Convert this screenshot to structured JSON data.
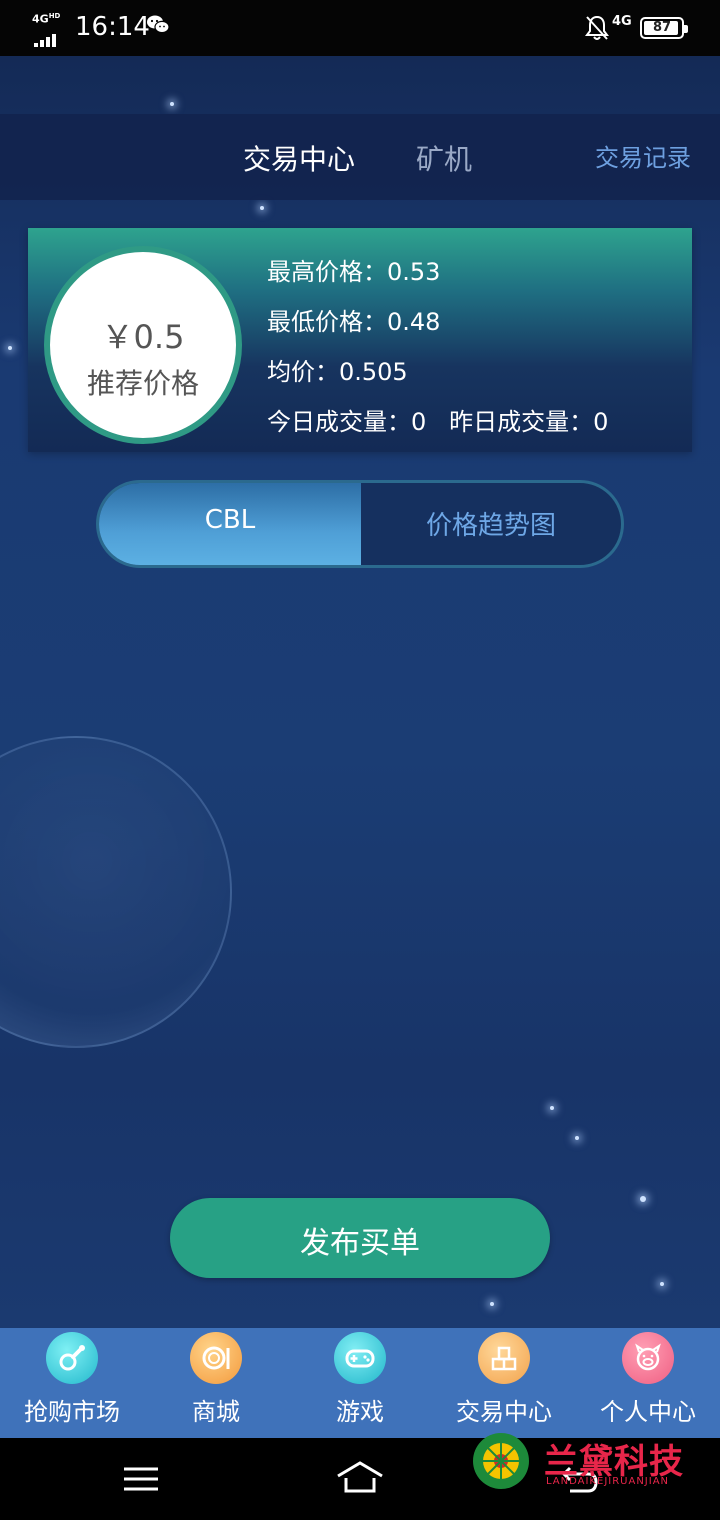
{
  "status_bar": {
    "network_tag": "4G",
    "network_tag_sup": "HD",
    "time": "16:14",
    "network_type": "4G",
    "battery": "87"
  },
  "header": {
    "tab_trade": "交易中心",
    "tab_miner": "矿机",
    "records_link": "交易记录"
  },
  "price_card": {
    "recommended_price": "￥0.5",
    "recommended_label": "推荐价格",
    "stats": {
      "high": "最高价格：0.53",
      "low": "最低价格：0.48",
      "avg": "均价：0.505",
      "volume": "今日成交量：0   昨日成交量：0"
    }
  },
  "toggle": {
    "cbl": "CBL",
    "trend": "价格趋势图"
  },
  "buy_button": "发布买单",
  "bottom_nav": {
    "items": [
      {
        "label": "抢购市场",
        "icon": "pacifier-icon",
        "color": "#2fc3d4"
      },
      {
        "label": "商城",
        "icon": "dish-icon",
        "color": "#f4a64b"
      },
      {
        "label": "游戏",
        "icon": "gamepad-icon",
        "color": "#2ec0d3"
      },
      {
        "label": "交易中心",
        "icon": "blocks-icon",
        "color": "#f4a64b"
      },
      {
        "label": "个人中心",
        "icon": "pig-icon",
        "color": "#f06a8a"
      }
    ]
  },
  "watermark": {
    "title": "兰黛科技",
    "subtitle": "LANDAIKEJIRUANJIAN"
  },
  "colors": {
    "accent_green": "#27a185",
    "nav_bar": "#3f72ba",
    "link_blue": "#6ea0e0",
    "watermark_red": "#e8264a"
  }
}
